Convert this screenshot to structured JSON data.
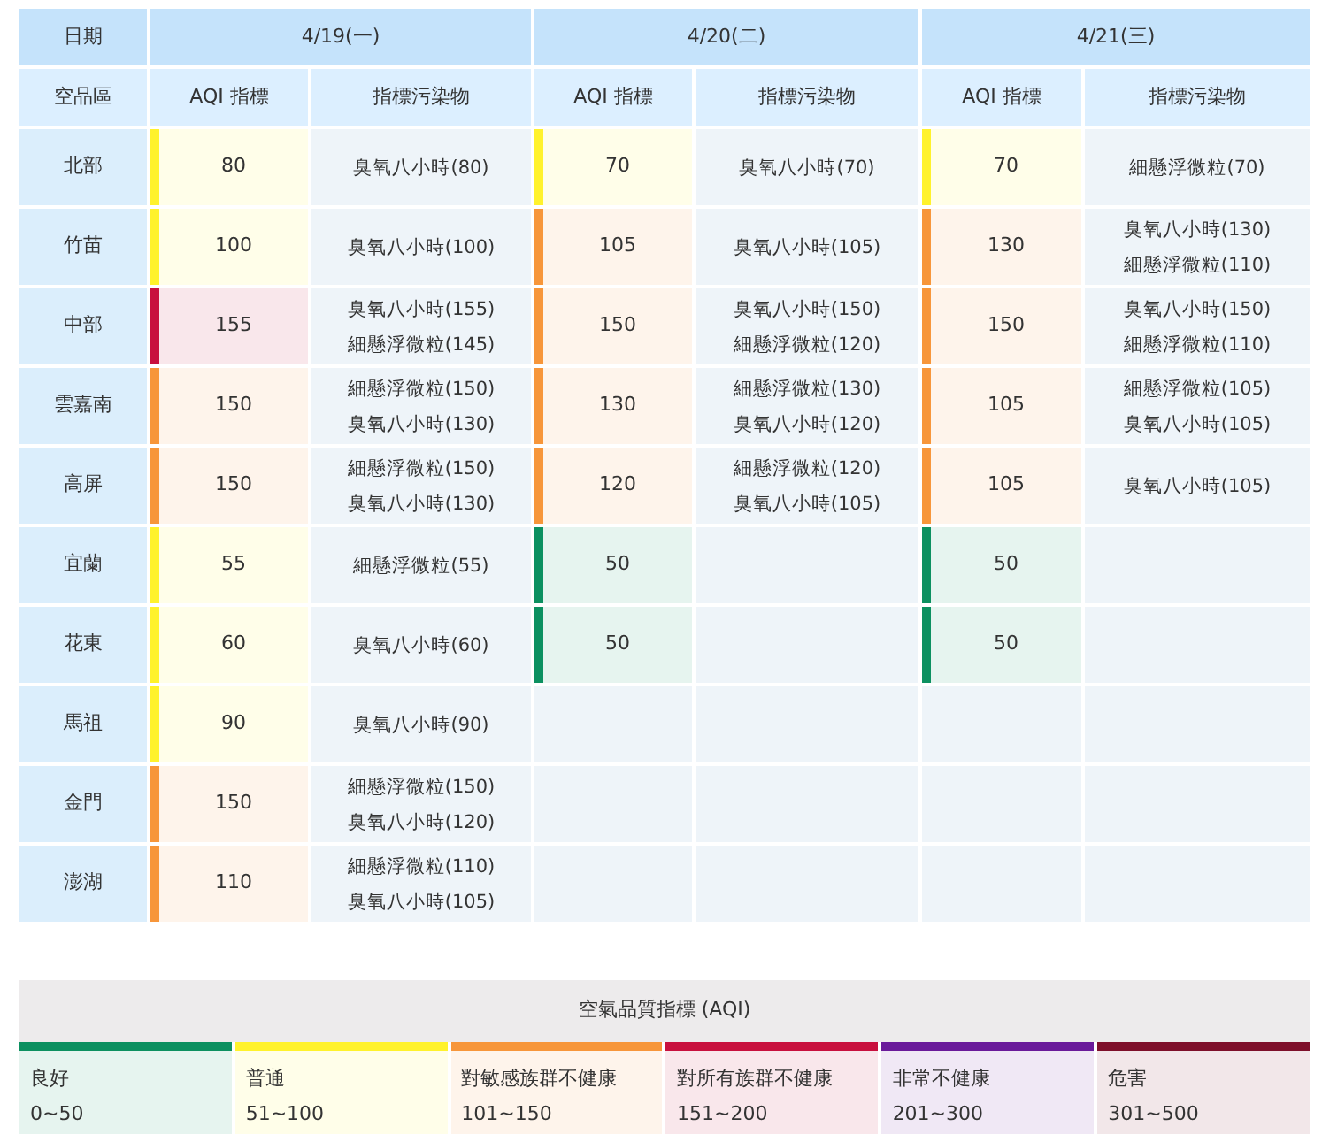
{
  "table": {
    "corner_top": "日期",
    "corner_sub": "空品區",
    "dates": [
      {
        "date": "4/19(一)",
        "sub_columns": [
          "AQI 指標",
          "指標污染物"
        ]
      },
      {
        "date": "4/20(二)",
        "sub_columns": [
          "AQI 指標",
          "指標污染物"
        ]
      },
      {
        "date": "4/21(三)",
        "sub_columns": [
          "AQI 指標",
          "指標污染物"
        ]
      }
    ],
    "rows": [
      {
        "region": "北部",
        "days": [
          {
            "aqi": "80",
            "color": "#fff22c",
            "pollutants": [
              "臭氧八小時(80)"
            ]
          },
          {
            "aqi": "70",
            "color": "#fff22c",
            "pollutants": [
              "臭氧八小時(70)"
            ]
          },
          {
            "aqi": "70",
            "color": "#fff22c",
            "pollutants": [
              "細懸浮微粒(70)"
            ]
          }
        ]
      },
      {
        "region": "竹苗",
        "days": [
          {
            "aqi": "100",
            "color": "#fff22c",
            "pollutants": [
              "臭氧八小時(100)"
            ]
          },
          {
            "aqi": "105",
            "color": "#f7963a",
            "pollutants": [
              "臭氧八小時(105)"
            ]
          },
          {
            "aqi": "130",
            "color": "#f7963a",
            "pollutants": [
              "臭氧八小時(130)",
              "細懸浮微粒(110)"
            ]
          }
        ]
      },
      {
        "region": "中部",
        "days": [
          {
            "aqi": "155",
            "color": "#c8103e",
            "pollutants": [
              "臭氧八小時(155)",
              "細懸浮微粒(145)"
            ]
          },
          {
            "aqi": "150",
            "color": "#f7963a",
            "pollutants": [
              "臭氧八小時(150)",
              "細懸浮微粒(120)"
            ]
          },
          {
            "aqi": "150",
            "color": "#f7963a",
            "pollutants": [
              "臭氧八小時(150)",
              "細懸浮微粒(110)"
            ]
          }
        ]
      },
      {
        "region": "雲嘉南",
        "days": [
          {
            "aqi": "150",
            "color": "#f7963a",
            "pollutants": [
              "細懸浮微粒(150)",
              "臭氧八小時(130)"
            ]
          },
          {
            "aqi": "130",
            "color": "#f7963a",
            "pollutants": [
              "細懸浮微粒(130)",
              "臭氧八小時(120)"
            ]
          },
          {
            "aqi": "105",
            "color": "#f7963a",
            "pollutants": [
              "細懸浮微粒(105)",
              "臭氧八小時(105)"
            ]
          }
        ]
      },
      {
        "region": "高屏",
        "days": [
          {
            "aqi": "150",
            "color": "#f7963a",
            "pollutants": [
              "細懸浮微粒(150)",
              "臭氧八小時(130)"
            ]
          },
          {
            "aqi": "120",
            "color": "#f7963a",
            "pollutants": [
              "細懸浮微粒(120)",
              "臭氧八小時(105)"
            ]
          },
          {
            "aqi": "105",
            "color": "#f7963a",
            "pollutants": [
              "臭氧八小時(105)"
            ]
          }
        ]
      },
      {
        "region": "宜蘭",
        "days": [
          {
            "aqi": "55",
            "color": "#fff22c",
            "pollutants": [
              "細懸浮微粒(55)"
            ]
          },
          {
            "aqi": "50",
            "color": "#0c9060"
          },
          {
            "aqi": "50",
            "color": "#0c9060"
          }
        ]
      },
      {
        "region": "花東",
        "days": [
          {
            "aqi": "60",
            "color": "#fff22c",
            "pollutants": [
              "臭氧八小時(60)"
            ]
          },
          {
            "aqi": "50",
            "color": "#0c9060"
          },
          {
            "aqi": "50",
            "color": "#0c9060"
          }
        ]
      },
      {
        "region": "馬祖",
        "days": [
          {
            "aqi": "90",
            "color": "#fff22c",
            "pollutants": [
              "臭氧八小時(90)"
            ]
          }
        ]
      },
      {
        "region": "金門",
        "days": [
          {
            "aqi": "150",
            "color": "#f7963a",
            "pollutants": [
              "細懸浮微粒(150)",
              "臭氧八小時(120)"
            ]
          }
        ]
      },
      {
        "region": "澎湖",
        "days": [
          {
            "aqi": "110",
            "color": "#f7963a",
            "pollutants": [
              "細懸浮微粒(110)",
              "臭氧八小時(105)"
            ]
          }
        ]
      }
    ]
  },
  "legend": {
    "title": "空氣品質指標 (AQI)",
    "items": [
      {
        "label": "良好",
        "range": "0~50",
        "color": "#0c9060"
      },
      {
        "label": "普通",
        "range": "51~100",
        "color": "#fff22c"
      },
      {
        "label": "對敏感族群不健康",
        "range": "101~150",
        "color": "#f7963a"
      },
      {
        "label": "對所有族群不健康",
        "range": "151~200",
        "color": "#c8103e"
      },
      {
        "label": "非常不健康",
        "range": "201~300",
        "color": "#6a1a9a"
      },
      {
        "label": "危害",
        "range": "301~500",
        "color": "#7e0f2a"
      }
    ]
  }
}
